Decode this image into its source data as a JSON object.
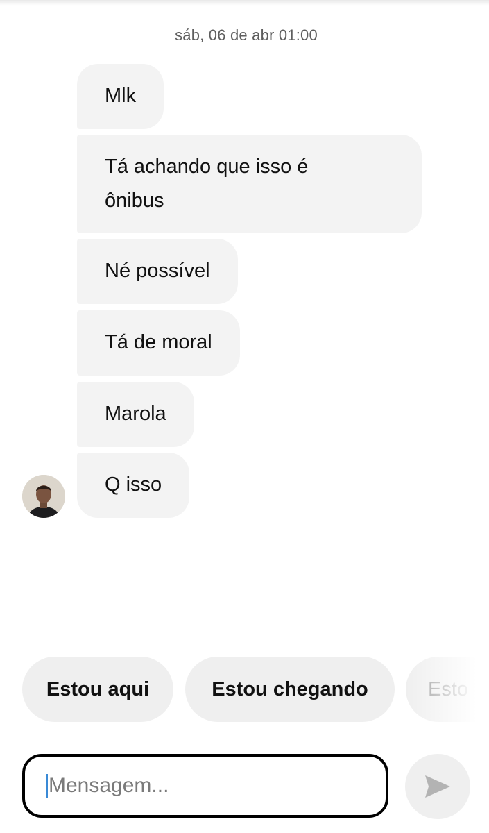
{
  "conversation": {
    "timestamp": "sáb, 06 de abr 01:00",
    "messages": [
      {
        "text": "Mlk"
      },
      {
        "text": "Tá achando que isso é\nônibus"
      },
      {
        "text": "Né possível"
      },
      {
        "text": "Tá de moral"
      },
      {
        "text": "Marola"
      },
      {
        "text": "Q isso"
      }
    ]
  },
  "quick_replies": [
    {
      "label": "Estou aqui"
    },
    {
      "label": "Estou chegando"
    },
    {
      "label": "Esto"
    }
  ],
  "composer": {
    "placeholder": "Mensagem...",
    "value": ""
  },
  "icons": {
    "avatar": "contact-avatar",
    "send": "send-arrow-icon"
  },
  "colors": {
    "bubble": "#f3f3f3",
    "chip": "#efefef",
    "caret": "#3a8ad6",
    "send_icon": "#b3b3b3"
  }
}
